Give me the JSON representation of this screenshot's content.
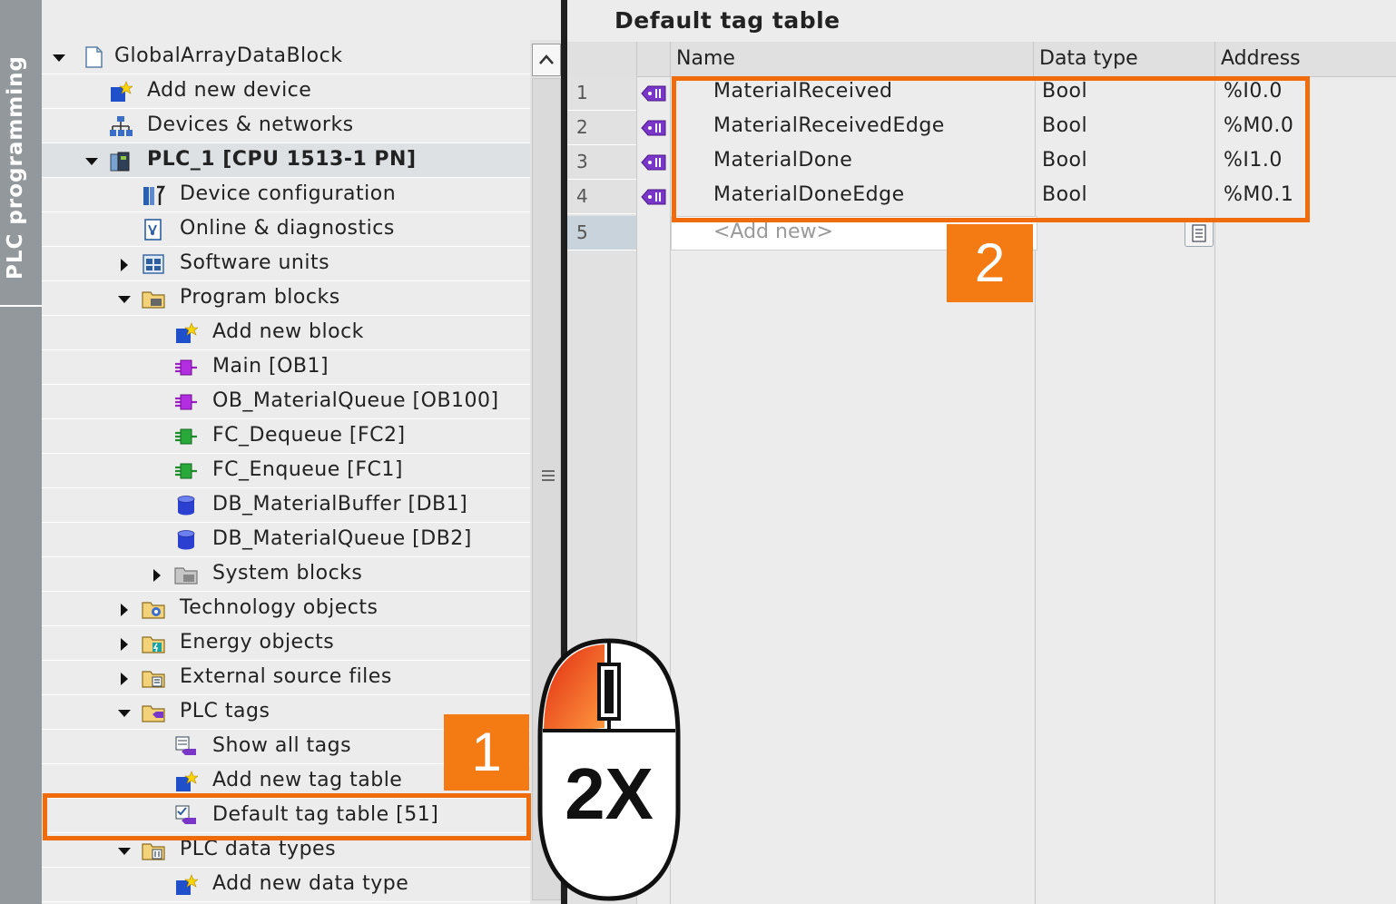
{
  "side_tab": {
    "label": "PLC programming"
  },
  "tree": {
    "items": [
      {
        "label": "GlobalArrayDataBlock",
        "level": 0,
        "arrow": "down",
        "icon": "document-icon"
      },
      {
        "label": "Add new device",
        "level": 1,
        "arrow": "none",
        "icon": "add-device-icon"
      },
      {
        "label": "Devices & networks",
        "level": 1,
        "arrow": "none",
        "icon": "network-icon"
      },
      {
        "label": "PLC_1 [CPU 1513-1 PN]",
        "level": 1,
        "arrow": "down",
        "icon": "plc-icon",
        "bold": true,
        "selected": true
      },
      {
        "label": "Device configuration",
        "level": 2,
        "arrow": "none",
        "icon": "device-config-icon"
      },
      {
        "label": "Online & diagnostics",
        "level": 2,
        "arrow": "none",
        "icon": "diagnostics-icon"
      },
      {
        "label": "Software units",
        "level": 2,
        "arrow": "right",
        "icon": "software-units-icon"
      },
      {
        "label": "Program blocks",
        "level": 2,
        "arrow": "down",
        "icon": "folder-icon"
      },
      {
        "label": "Add new block",
        "level": 3,
        "arrow": "none",
        "icon": "add-block-icon"
      },
      {
        "label": "Main [OB1]",
        "level": 3,
        "arrow": "none",
        "icon": "ob-block-icon"
      },
      {
        "label": "OB_MaterialQueue [OB100]",
        "level": 3,
        "arrow": "none",
        "icon": "ob-block-icon"
      },
      {
        "label": "FC_Dequeue [FC2]",
        "level": 3,
        "arrow": "none",
        "icon": "fc-block-icon"
      },
      {
        "label": "FC_Enqueue [FC1]",
        "level": 3,
        "arrow": "none",
        "icon": "fc-block-icon"
      },
      {
        "label": "DB_MaterialBuffer [DB1]",
        "level": 3,
        "arrow": "none",
        "icon": "db-block-icon"
      },
      {
        "label": "DB_MaterialQueue [DB2]",
        "level": 3,
        "arrow": "none",
        "icon": "db-block-icon"
      },
      {
        "label": "System blocks",
        "level": 3,
        "arrow": "right",
        "icon": "system-blocks-icon"
      },
      {
        "label": "Technology objects",
        "level": 2,
        "arrow": "right",
        "icon": "tech-objects-icon"
      },
      {
        "label": "Energy objects",
        "level": 2,
        "arrow": "right",
        "icon": "energy-objects-icon"
      },
      {
        "label": "External source files",
        "level": 2,
        "arrow": "right",
        "icon": "external-source-icon"
      },
      {
        "label": "PLC tags",
        "level": 2,
        "arrow": "down",
        "icon": "plc-tags-folder-icon"
      },
      {
        "label": "Show all tags",
        "level": 3,
        "arrow": "none",
        "icon": "show-tags-icon"
      },
      {
        "label": "Add new tag table",
        "level": 3,
        "arrow": "none",
        "icon": "add-tag-table-icon"
      },
      {
        "label": "Default tag table [51]",
        "level": 3,
        "arrow": "none",
        "icon": "tag-table-icon",
        "selected": true
      },
      {
        "label": "PLC data types",
        "level": 2,
        "arrow": "down",
        "icon": "data-types-folder-icon"
      },
      {
        "label": "Add new data type",
        "level": 3,
        "arrow": "none",
        "icon": "add-data-type-icon"
      }
    ]
  },
  "editor": {
    "title": "Default tag table",
    "columns": {
      "name": "Name",
      "data_type": "Data type",
      "address": "Address"
    },
    "rows": [
      {
        "num": "1",
        "name": "MaterialReceived",
        "type": "Bool",
        "address": "%I0.0"
      },
      {
        "num": "2",
        "name": "MaterialReceivedEdge",
        "type": "Bool",
        "address": "%M0.0"
      },
      {
        "num": "3",
        "name": "MaterialDone",
        "type": "Bool",
        "address": "%I1.0"
      },
      {
        "num": "4",
        "name": "MaterialDoneEdge",
        "type": "Bool",
        "address": "%M0.1"
      }
    ],
    "add_row": {
      "num": "5",
      "placeholder": "<Add new>"
    }
  },
  "annotations": {
    "callout_1": "1",
    "callout_2": "2",
    "mouse_label": "2X",
    "highlight_color": "#f06b0b",
    "callout_color": "#f47b14"
  }
}
